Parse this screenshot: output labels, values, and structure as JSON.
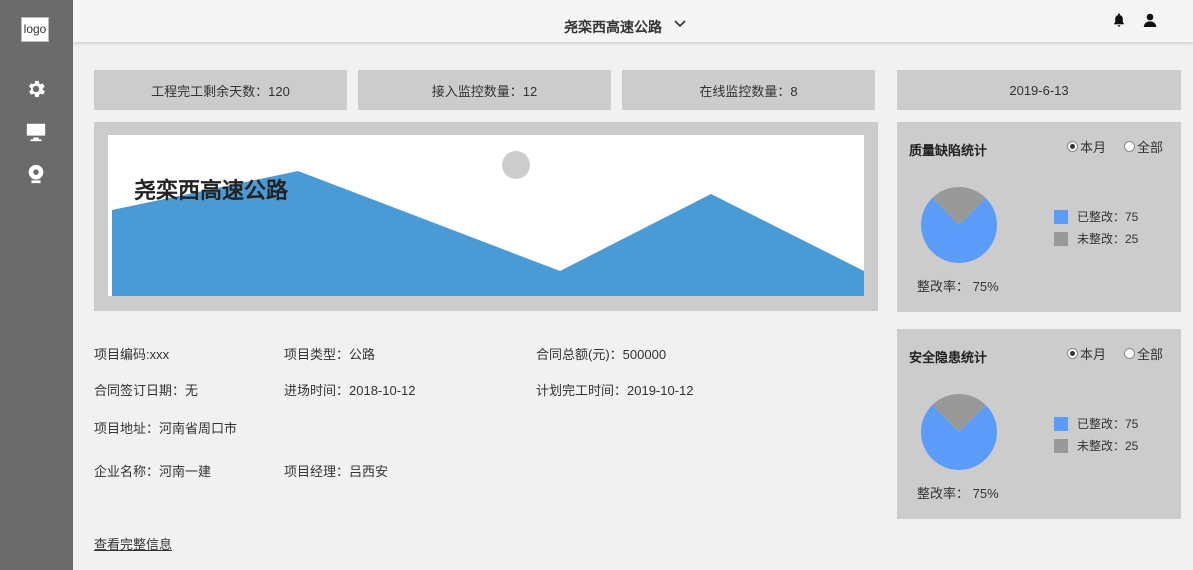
{
  "sidebar": {
    "logo": "logo",
    "items": [
      {
        "icon": "gear-icon"
      },
      {
        "icon": "monitor-icon"
      },
      {
        "icon": "webcam-icon"
      }
    ]
  },
  "header": {
    "title": "尧栾西高速公路",
    "icons": [
      "bell-icon",
      "user-icon"
    ]
  },
  "stats": [
    {
      "text": "工程完工剩余天数：120"
    },
    {
      "text": "接入监控数量：12"
    },
    {
      "text": "在线监控数量：8"
    }
  ],
  "date": "2019-6-13",
  "banner": {
    "title": "尧栾西高速公路",
    "colors": {
      "mountain": "#4a9ad6",
      "sun": "#cccccc"
    }
  },
  "info": {
    "code": {
      "label": "项目编码:",
      "value": "xxx"
    },
    "type": {
      "label": "项目类型：",
      "value": "公路"
    },
    "amount": {
      "label": "合同总额(元)：",
      "value": "500000"
    },
    "sign_date": {
      "label": "合同签订日期：",
      "value": "无"
    },
    "entry_time": {
      "label": "进场时间：",
      "value": "2018-10-12"
    },
    "plan_finish": {
      "label": "计划完工时间：",
      "value": "2019-10-12"
    },
    "address": {
      "label": "项目地址：",
      "value": "河南省周口市"
    },
    "company": {
      "label": "企业名称：",
      "value": "河南一建"
    },
    "manager": {
      "label": "项目经理：",
      "value": "吕西安"
    },
    "more_link": "查看完整信息"
  },
  "quality": {
    "title": "质量缺陷统计",
    "radio_month": "本月",
    "radio_all": "全部",
    "selected": "本月",
    "legend_done": "已整改：75",
    "legend_undone": "未整改：25",
    "rate": "整改率：  75%",
    "chart_data": {
      "type": "pie",
      "categories": [
        "已整改",
        "未整改"
      ],
      "values": [
        75,
        25
      ],
      "colors": [
        "#5b9cf8",
        "#999999"
      ]
    }
  },
  "safety": {
    "title": "安全隐患统计",
    "radio_month": "本月",
    "radio_all": "全部",
    "selected": "本月",
    "legend_done": "已整改：75",
    "legend_undone": "未整改：25",
    "rate": "整改率：  75%",
    "chart_data": {
      "type": "pie",
      "categories": [
        "已整改",
        "未整改"
      ],
      "values": [
        75,
        25
      ],
      "colors": [
        "#5b9cf8",
        "#999999"
      ]
    }
  }
}
